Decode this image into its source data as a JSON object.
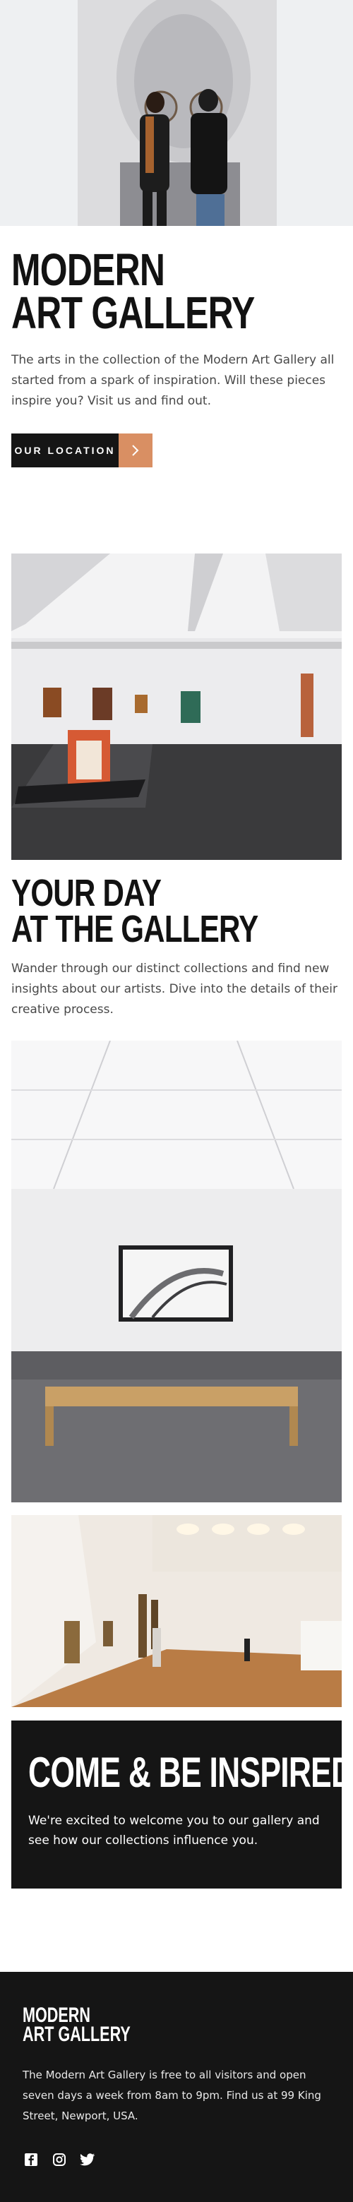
{
  "hero": {
    "title_line1": "MODERN",
    "title_line2": "ART GALLERY",
    "intro": "The arts in the collection of the Modern Art Gallery all started from a spark of inspiration. Will these pieces inspire you? Visit us and find out.",
    "button_label": "OUR LOCATION",
    "button_icon": "chevron-right-icon"
  },
  "section_day": {
    "title_line1": "YOUR DAY",
    "title_line2": "AT THE GALLERY",
    "text": "Wander through our distinct collections and find new insights about our artists. Dive into the details of their creative process."
  },
  "inspire": {
    "title": "COME & BE INSPIRED",
    "text": "We're excited to welcome you to our gallery and see how our collections influence you."
  },
  "footer": {
    "logo_line1": "MODERN",
    "logo_line2": "ART GALLERY",
    "text": "The Modern Art Gallery is free to all visitors and open seven days a week from 8am to 9pm. Find us at 99 King Street, Newport, USA.",
    "social": [
      "facebook-icon",
      "instagram-icon",
      "twitter-icon"
    ]
  },
  "colors": {
    "accent": "#d98f63",
    "dark": "#151515",
    "text": "#484848"
  }
}
